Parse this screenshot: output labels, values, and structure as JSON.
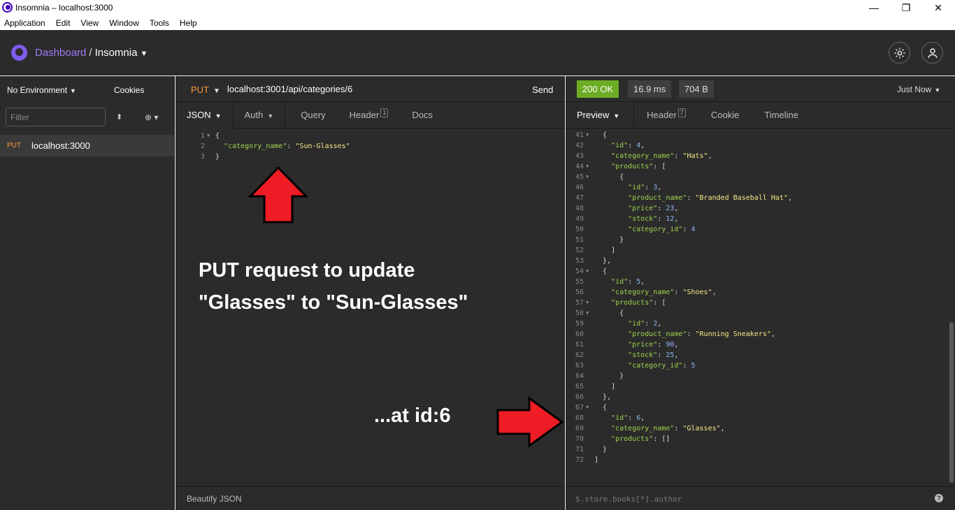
{
  "window": {
    "title": "Insomnia – localhost:3000",
    "minimize": "—",
    "maximize": "❐",
    "close": "✕"
  },
  "menu": [
    "Application",
    "Edit",
    "View",
    "Window",
    "Tools",
    "Help"
  ],
  "header": {
    "dashboard": "Dashboard",
    "separator": "/",
    "workspace": "Insomnia",
    "caret": "▼"
  },
  "sidebar": {
    "environment": "No Environment",
    "cookies": "Cookies",
    "filter_placeholder": "Filter",
    "request": {
      "method": "PUT",
      "name": "localhost:3000"
    }
  },
  "request": {
    "method": "PUT",
    "url": "localhost:3001/api/categories/6",
    "send": "Send",
    "tabs": [
      {
        "label": "JSON"
      },
      {
        "label": "Auth"
      },
      {
        "label": "Query"
      },
      {
        "label": "Header",
        "badge": "1"
      },
      {
        "label": "Docs"
      }
    ],
    "footer": "Beautify JSON",
    "body_lines": [
      {
        "n": "1",
        "fold": true,
        "html": "{"
      },
      {
        "n": "2",
        "fold": false,
        "html": "  <span class='k'>\"category_name\"</span>: <span class='s'>\"Sun-Glasses\"</span>"
      },
      {
        "n": "3",
        "fold": false,
        "html": "}"
      }
    ]
  },
  "annotations": {
    "line1": "PUT request to update",
    "line2": "\"Glasses\" to \"Sun-Glasses\"",
    "line3": "...at id:6",
    "arrow_color": "#ee1c24"
  },
  "response": {
    "status": "200 OK",
    "time": "16.9 ms",
    "size": "704 B",
    "when": "Just Now",
    "tabs": [
      {
        "label": "Preview"
      },
      {
        "label": "Header",
        "badge": "7"
      },
      {
        "label": "Cookie"
      },
      {
        "label": "Timeline"
      }
    ],
    "filter_placeholder": "$.store.books[*].author",
    "help": "?",
    "status_color": "#6cad24",
    "lines": [
      {
        "n": "41",
        "fold": true,
        "html": "  {"
      },
      {
        "n": "42",
        "fold": false,
        "html": "    <span class='k'>\"id\"</span>: <span class='n'>4</span>,"
      },
      {
        "n": "43",
        "fold": false,
        "html": "    <span class='k'>\"category_name\"</span>: <span class='s'>\"Hats\"</span>,"
      },
      {
        "n": "44",
        "fold": true,
        "html": "    <span class='k'>\"products\"</span>: ["
      },
      {
        "n": "45",
        "fold": true,
        "html": "      {"
      },
      {
        "n": "46",
        "fold": false,
        "html": "        <span class='k'>\"id\"</span>: <span class='n'>3</span>,"
      },
      {
        "n": "47",
        "fold": false,
        "html": "        <span class='k'>\"product_name\"</span>: <span class='s'>\"Branded Baseball Hat\"</span>,"
      },
      {
        "n": "48",
        "fold": false,
        "html": "        <span class='k'>\"price\"</span>: <span class='n'>23</span>,"
      },
      {
        "n": "49",
        "fold": false,
        "html": "        <span class='k'>\"stock\"</span>: <span class='n'>12</span>,"
      },
      {
        "n": "50",
        "fold": false,
        "html": "        <span class='k'>\"category_id\"</span>: <span class='n'>4</span>"
      },
      {
        "n": "51",
        "fold": false,
        "html": "      }"
      },
      {
        "n": "52",
        "fold": false,
        "html": "    ]"
      },
      {
        "n": "53",
        "fold": false,
        "html": "  },"
      },
      {
        "n": "54",
        "fold": true,
        "html": "  {"
      },
      {
        "n": "55",
        "fold": false,
        "html": "    <span class='k'>\"id\"</span>: <span class='n'>5</span>,"
      },
      {
        "n": "56",
        "fold": false,
        "html": "    <span class='k'>\"category_name\"</span>: <span class='s'>\"Shoes\"</span>,"
      },
      {
        "n": "57",
        "fold": true,
        "html": "    <span class='k'>\"products\"</span>: ["
      },
      {
        "n": "58",
        "fold": true,
        "html": "      {"
      },
      {
        "n": "59",
        "fold": false,
        "html": "        <span class='k'>\"id\"</span>: <span class='n'>2</span>,"
      },
      {
        "n": "60",
        "fold": false,
        "html": "        <span class='k'>\"product_name\"</span>: <span class='s'>\"Running Sneakers\"</span>,"
      },
      {
        "n": "61",
        "fold": false,
        "html": "        <span class='k'>\"price\"</span>: <span class='n'>90</span>,"
      },
      {
        "n": "62",
        "fold": false,
        "html": "        <span class='k'>\"stock\"</span>: <span class='n'>25</span>,"
      },
      {
        "n": "63",
        "fold": false,
        "html": "        <span class='k'>\"category_id\"</span>: <span class='n'>5</span>"
      },
      {
        "n": "64",
        "fold": false,
        "html": "      }"
      },
      {
        "n": "65",
        "fold": false,
        "html": "    ]"
      },
      {
        "n": "66",
        "fold": false,
        "html": "  },"
      },
      {
        "n": "67",
        "fold": true,
        "html": "  {"
      },
      {
        "n": "68",
        "fold": false,
        "html": "    <span class='k'>\"id\"</span>: <span class='n'>6</span>,"
      },
      {
        "n": "69",
        "fold": false,
        "html": "    <span class='k'>\"category_name\"</span>: <span class='s'>\"Glasses\"</span>,"
      },
      {
        "n": "70",
        "fold": false,
        "html": "    <span class='k'>\"products\"</span>: []"
      },
      {
        "n": "71",
        "fold": false,
        "html": "  }"
      },
      {
        "n": "72",
        "fold": false,
        "html": "]"
      }
    ]
  }
}
